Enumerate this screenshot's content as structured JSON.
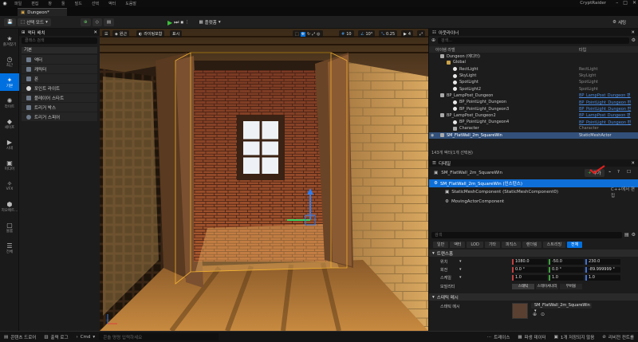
{
  "menubar": {
    "items": [
      "파일",
      "편집",
      "창",
      "툴",
      "빌드",
      "선택",
      "액터",
      "도움말"
    ],
    "project": "CryptRaider"
  },
  "tab": {
    "label": "Dungeon*"
  },
  "toolbar": {
    "save_icon": "save-icon",
    "mode_label": "선택 모드",
    "platforms_label": "플랫폼",
    "settings_label": "세팅"
  },
  "rail": {
    "items": [
      {
        "icon": "star-icon",
        "label": "즐겨찾기"
      },
      {
        "icon": "clock-icon",
        "label": "최근"
      },
      {
        "icon": "basic-icon",
        "label": "기본"
      },
      {
        "icon": "lightbulb-icon",
        "label": "라이트"
      },
      {
        "icon": "shapes-icon",
        "label": "셰이프"
      },
      {
        "icon": "visual-icon",
        "label": "시네"
      },
      {
        "icon": "media-icon",
        "label": "미디어"
      },
      {
        "icon": "vfx-icon",
        "label": "VFX"
      },
      {
        "icon": "geometry-icon",
        "label": "지오메트..."
      },
      {
        "icon": "volume-icon",
        "label": "볼륨"
      },
      {
        "icon": "all-icon",
        "label": "전체"
      }
    ]
  },
  "place": {
    "title": "액터 배치",
    "search_placeholder": "클래스 검색",
    "category": "기본",
    "items": [
      "액터",
      "캐릭터",
      "폰",
      "포인트 라이트",
      "플레이어 스타트",
      "트리거 박스",
      "트리거 스피어"
    ]
  },
  "viewport": {
    "perspective": "원근",
    "lit": "라이팅포함",
    "show": "표시",
    "grid_snap": "10",
    "rot_snap": "10°",
    "scale_snap": "0.25",
    "cam_speed": "4"
  },
  "outliner": {
    "title": "아웃라이너",
    "search_placeholder": "검색...",
    "col_label": "아이템 라벨",
    "col_type": "타입",
    "rows": [
      {
        "name": "Dungeon (에디터)",
        "type": "",
        "icon": "world",
        "indent": 1
      },
      {
        "name": "Global",
        "type": "",
        "icon": "fold",
        "indent": 2
      },
      {
        "name": "RectLight",
        "type": "RectLight",
        "icon": "light",
        "indent": 3
      },
      {
        "name": "SkyLight",
        "type": "SkyLight",
        "icon": "light",
        "indent": 3
      },
      {
        "name": "SpotLight",
        "type": "SpotLight",
        "icon": "light",
        "indent": 3
      },
      {
        "name": "SpotLight2",
        "type": "SpotLight",
        "icon": "light",
        "indent": 3
      },
      {
        "name": "BP_LampPost_Dungeon",
        "type": "BP_LampPost_Dungeon 편",
        "icon": "bp",
        "indent": 1,
        "link": true
      },
      {
        "name": "BP_PointLight_Dungeon",
        "type": "BP_PointLight_Dungeon 편",
        "icon": "light",
        "indent": 3,
        "link": true
      },
      {
        "name": "BP_PointLight_Dungeon3",
        "type": "BP_PointLight_Dungeon 편",
        "icon": "light",
        "indent": 3,
        "link": true
      },
      {
        "name": "BP_LampPost_Dungeon2",
        "type": "BP_LampPost_Dungeon 편",
        "icon": "bp",
        "indent": 1,
        "link": true
      },
      {
        "name": "BP_PointLight_Dungeon4",
        "type": "BP_PointLight_Dungeon 편",
        "icon": "light",
        "indent": 3,
        "link": true
      },
      {
        "name": "Character",
        "type": "Character",
        "icon": "actor",
        "indent": 3
      },
      {
        "name": "SM_FlatWall_2m_SquareWin",
        "type": "StaticMeshActor",
        "icon": "mesh",
        "indent": 1,
        "selected": true
      }
    ],
    "footer": "143개 액터(1개 선택됨)"
  },
  "details": {
    "title": "디테일",
    "actor_name": "SM_FlatWall_2m_SquareWin",
    "add_label": "추가",
    "instance_row": "SM_FlatWall_2m_SquareWin (인스턴스)",
    "component_row": "StaticMeshComponent (StaticMeshComponent0)",
    "component_right": "C++에서 편집",
    "moving_row": "MovingActorComponent",
    "search_placeholder": "검색",
    "tabs": [
      "일반",
      "액터",
      "LOD",
      "기타",
      "피직스",
      "렌더링",
      "스트리밍",
      "전체"
    ],
    "transform_section": "트랜스폼",
    "location_label": "위치",
    "rotation_label": "회전",
    "scale_label": "스케일",
    "mobility_label": "모빌리티",
    "location": [
      "1080.0",
      "-50.0",
      "230.0"
    ],
    "rotation": [
      "0.0 °",
      "0.0 °",
      "-89.999999 °"
    ],
    "scale": [
      "1.0",
      "1.0",
      "1.0"
    ],
    "mobility": [
      "스태틱",
      "스테이셔너리",
      "무버블"
    ],
    "mesh_section": "스태틱 메시",
    "mesh_label": "스태틱 메시",
    "mesh_value": "SM_FlatWall_2m_SquareWin",
    "advanced_section": "고급"
  },
  "status": {
    "content_drawer": "콘텐츠 드로어",
    "output_log": "출력 로그",
    "cmd": "Cmd",
    "console_placeholder": "콘솔 명령 입력하세요",
    "trace": "트레이스",
    "derived_data": "파생 데이터",
    "unsaved": "1개 저장되지 않음",
    "revision": "리비전 컨트롤"
  }
}
